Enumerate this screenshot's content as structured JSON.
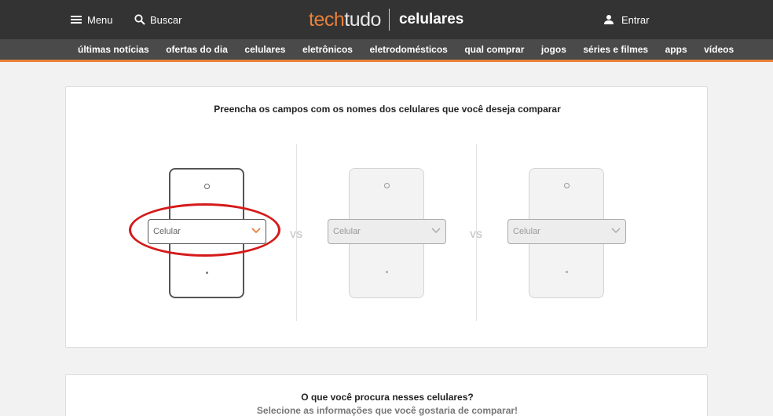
{
  "header": {
    "menu_label": "Menu",
    "search_label": "Buscar",
    "logo": {
      "tech": "tech",
      "tudo": "tudo",
      "section": "celulares"
    },
    "login_label": "Entrar",
    "accent_color": "#e8813a"
  },
  "nav": {
    "items": [
      "últimas notícias",
      "ofertas do dia",
      "celulares",
      "eletrônicos",
      "eletrodomésticos",
      "qual comprar",
      "jogos",
      "séries e filmes",
      "apps",
      "vídeos"
    ]
  },
  "compare": {
    "title": "Preencha os campos com os nomes dos celulares que você deseja comparar",
    "vs_label": "VS",
    "phones": [
      {
        "placeholder": "Celular",
        "state": "active"
      },
      {
        "placeholder": "Celular",
        "state": "inactive"
      },
      {
        "placeholder": "Celular",
        "state": "inactive"
      }
    ],
    "highlight_color": "#d51a1a"
  },
  "info": {
    "title": "O que você procura nesses celulares?",
    "subtitle": "Selecione as informações que você gostaria de comparar!"
  }
}
